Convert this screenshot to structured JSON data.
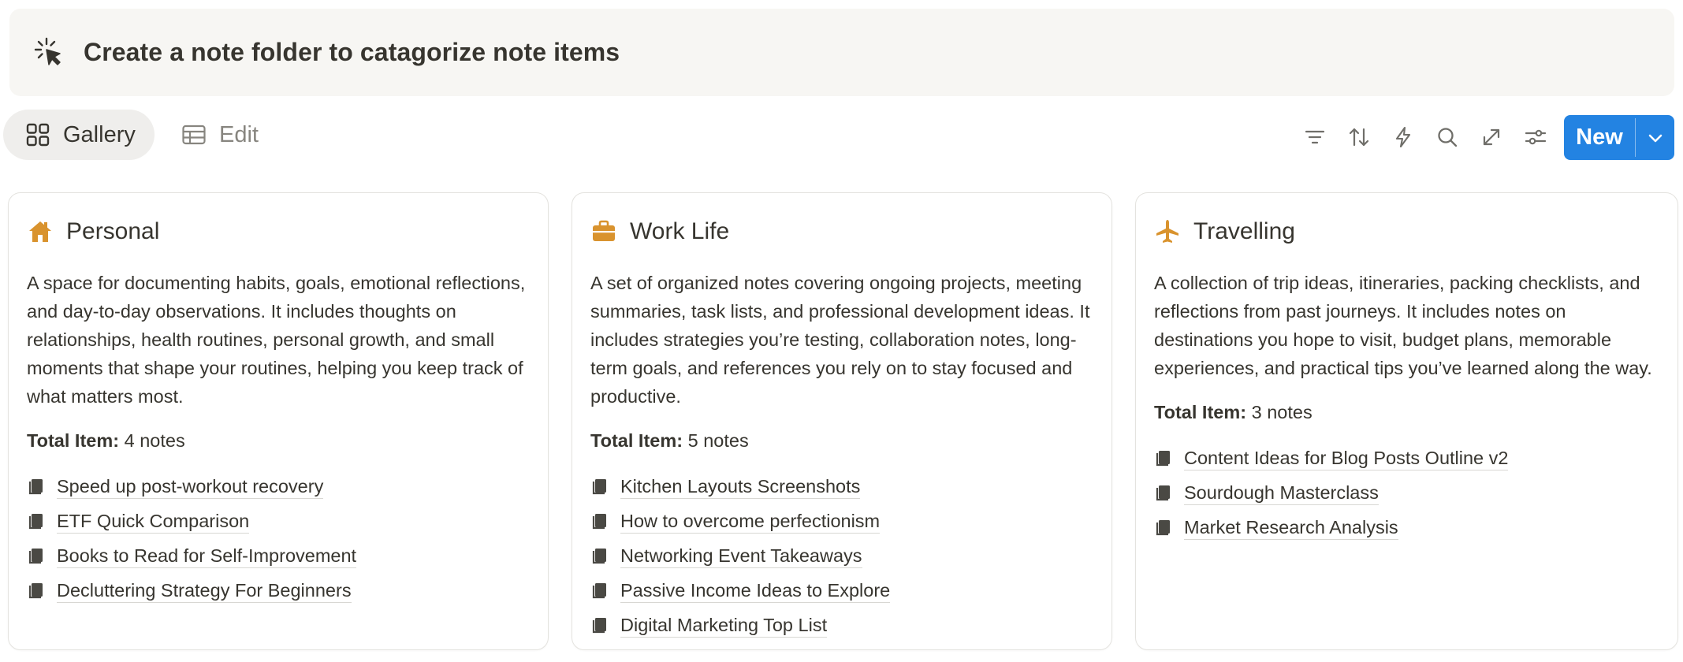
{
  "banner": {
    "title": "Create a note folder to catagorize note items",
    "icon": "click-cursor-icon"
  },
  "views": {
    "gallery_label": "Gallery",
    "edit_label": "Edit",
    "active": "Gallery"
  },
  "toolbar": {
    "tools": [
      "filter-icon",
      "sort-icon",
      "lightning-icon",
      "search-icon",
      "expand-icon",
      "settings-sliders-icon"
    ],
    "new_label": "New"
  },
  "colors": {
    "accent": "#2383e2",
    "icon_gold": "#d9932e",
    "text": "#37352f",
    "muted": "#87857f"
  },
  "cards": [
    {
      "icon": "house-icon",
      "title": "Personal",
      "description": "A space for documenting habits, goals, emotional reflections, and day-to-day observations. It includes thoughts on relationships, health routines, personal growth, and small moments that shape your routines, helping you keep track of what matters most.",
      "total_label": "Total Item:",
      "total_value": "4 notes",
      "notes": [
        "Speed up post-workout recovery",
        "ETF Quick Comparison",
        "Books to Read for Self-Improvement",
        "Decluttering Strategy For Beginners"
      ]
    },
    {
      "icon": "briefcase-icon",
      "title": "Work Life",
      "description": "A set of organized notes covering ongoing projects, meeting summaries, task lists, and professional development ideas. It includes strategies you’re testing, collaboration notes, long-term goals, and references you rely on to stay focused and productive.",
      "total_label": "Total Item:",
      "total_value": "5 notes",
      "notes": [
        "Kitchen Layouts Screenshots",
        "How to overcome perfectionism",
        "Networking Event Takeaways",
        "Passive Income Ideas to Explore",
        "Digital Marketing Top List"
      ]
    },
    {
      "icon": "airplane-icon",
      "title": "Travelling",
      "description": "A collection of trip ideas, itineraries, packing checklists, and reflections from past journeys. It includes notes on destinations you hope to visit, budget plans, memorable experiences, and practical tips you’ve learned along the way.",
      "total_label": "Total Item:",
      "total_value": "3 notes",
      "notes": [
        "Content Ideas for Blog Posts Outline v2",
        "Sourdough Masterclass",
        "Market Research Analysis"
      ]
    }
  ]
}
